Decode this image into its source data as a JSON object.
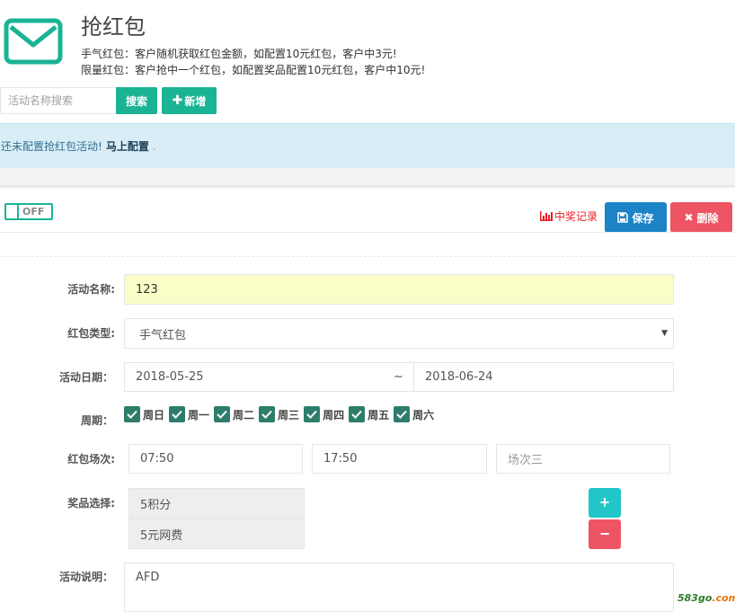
{
  "header": {
    "title": "抢红包",
    "desc_line1": "手气红包：客户随机获取红包金额，如配置10元红包，客户中3元!",
    "desc_line2": "限量红包：客户抢中一个红包，如配置奖品配置10元红包，客户中10元!"
  },
  "toolbar": {
    "search_placeholder": "活动名称搜索",
    "search_label": "搜索",
    "add_label": "新增"
  },
  "alert": {
    "text": "还未配置抢红包活动!",
    "link": "马上配置",
    "suffix": "."
  },
  "panel": {
    "toggle_label": "OFF",
    "record_label": "中奖记录",
    "save_label": "保存",
    "delete_label": "删除"
  },
  "form": {
    "name_label": "活动名称:",
    "name_value": "123",
    "type_label": "红包类型:",
    "type_value": "手气红包",
    "date_label": "活动日期：",
    "date_start": "2018-05-25",
    "date_sep": "~",
    "date_end": "2018-06-24",
    "period_label": "周期：",
    "weekdays": [
      "周日",
      "周一",
      "周二",
      "周三",
      "周四",
      "周五",
      "周六"
    ],
    "session_label": "红包场次:",
    "session1": "07:50",
    "session2": "17:50",
    "session3_placeholder": "场次三",
    "prize_label": "奖品选择:",
    "prizes": [
      "5积分",
      "5元网费"
    ],
    "desc_label": "活动说明：",
    "desc_value": "AFD"
  },
  "watermark": {
    "part1": "583go",
    "part2": ".com"
  },
  "colors": {
    "primary": "#1ab394",
    "info_blue": "#1c84c6",
    "danger": "#ed5565",
    "cyan": "#23c6c8",
    "alert_bg": "#d9edf7",
    "highlight_input": "#fbfdc8"
  }
}
